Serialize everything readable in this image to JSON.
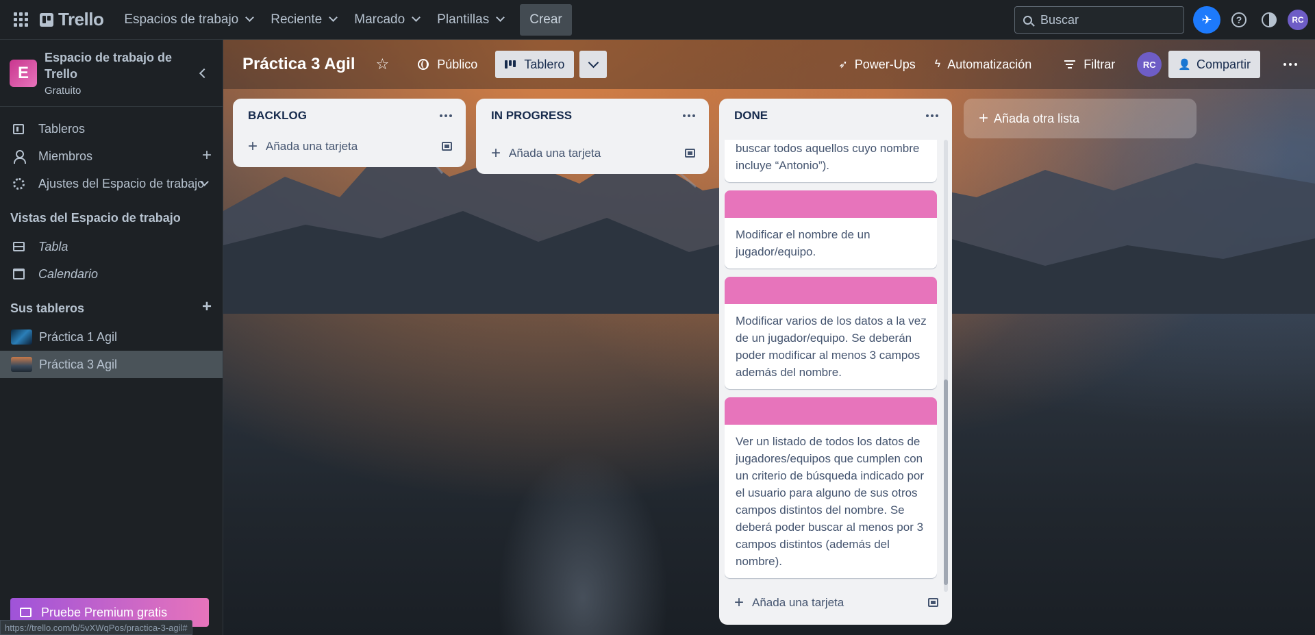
{
  "topbar": {
    "logo": "Trello",
    "nav": [
      {
        "label": "Espacios de trabajo"
      },
      {
        "label": "Reciente"
      },
      {
        "label": "Marcado"
      },
      {
        "label": "Plantillas"
      }
    ],
    "create_label": "Crear",
    "search_placeholder": "Buscar",
    "avatar_initials": "RC"
  },
  "sidebar": {
    "workspace_initial": "E",
    "workspace_name": "Espacio de trabajo de Trello",
    "workspace_plan": "Gratuito",
    "items": [
      {
        "label": "Tableros"
      },
      {
        "label": "Miembros"
      },
      {
        "label": "Ajustes del Espacio de trabajo"
      }
    ],
    "views_title": "Vistas del Espacio de trabajo",
    "views": [
      {
        "label": "Tabla"
      },
      {
        "label": "Calendario"
      }
    ],
    "boards_title": "Sus tableros",
    "boards": [
      {
        "label": "Práctica 1 Agil"
      },
      {
        "label": "Práctica 3 Agil"
      }
    ],
    "premium_label": "Pruebe Premium gratis",
    "status_url": "https://trello.com/b/5vXWqPos/practica-3-agil#"
  },
  "board": {
    "title": "Práctica 3 Agil",
    "visibility_label": "Público",
    "view_label": "Tablero",
    "powerups_label": "Power-Ups",
    "automation_label": "Automatización",
    "filter_label": "Filtrar",
    "member_initials": "RC",
    "share_label": "Compartir",
    "add_list_label": "Añada otra lista"
  },
  "lists": [
    {
      "title": "BACKLOG",
      "add_card_label": "Añada una tarjeta",
      "cards": []
    },
    {
      "title": "IN PROGRESS",
      "add_card_label": "Añada una tarjeta",
      "cards": []
    },
    {
      "title": "DONE",
      "add_card_label": "Añada una tarjeta",
      "cards": [
        {
          "text": "indicado por el usuario. (Por ejemplo: buscar todos aquellos cuyo nombre incluye “Antonio”).",
          "cover": false
        },
        {
          "text": "Modificar el nombre de un jugador/equipo.",
          "cover": true
        },
        {
          "text": "Modificar varios de los datos a la vez de un jugador/equipo. Se deberán poder modificar al menos 3 campos además del nombre.",
          "cover": true
        },
        {
          "text": "Ver un listado de todos los datos de jugadores/equipos que cumplen con un criterio de búsqueda indicado por el usuario para alguno de sus otros campos distintos del nombre. Se deberá poder buscar al menos por 3 campos distintos (además del nombre).",
          "cover": true
        }
      ]
    }
  ],
  "colors": {
    "card_cover": "#e774bb",
    "accent_blue": "#1d7afc",
    "avatar": "#6e5dc6"
  }
}
